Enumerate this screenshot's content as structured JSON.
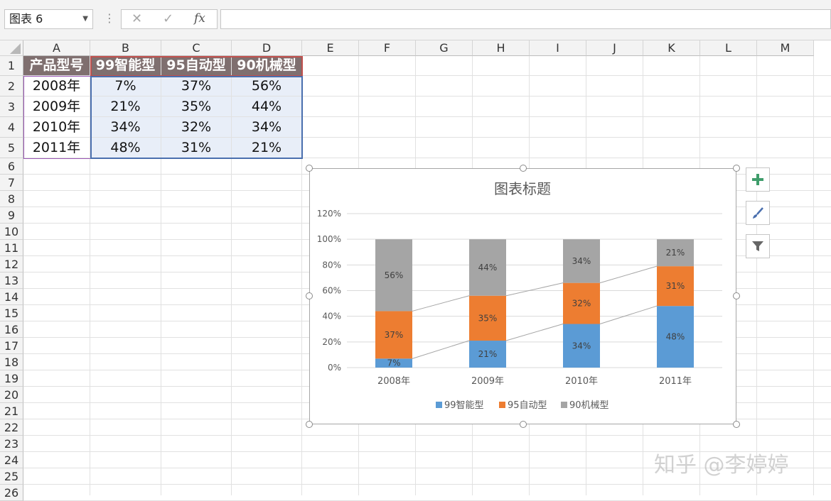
{
  "formula_bar": {
    "name_box": "图表 6",
    "cancel_icon": "✕",
    "enter_icon": "✓",
    "fx_icon": "fx",
    "formula": ""
  },
  "columns": [
    "A",
    "B",
    "C",
    "D",
    "E",
    "F",
    "G",
    "H",
    "I",
    "J",
    "K",
    "L",
    "M"
  ],
  "rows": [
    "1",
    "2",
    "3",
    "4",
    "5",
    "6",
    "7",
    "8",
    "9",
    "10",
    "11",
    "12",
    "13",
    "14",
    "15",
    "16",
    "17",
    "18",
    "19",
    "20",
    "21",
    "22",
    "23",
    "24",
    "25",
    "26"
  ],
  "table": {
    "headers": [
      "产品型号",
      "99智能型",
      "95自动型",
      "90机械型"
    ],
    "rows": [
      [
        "2008年",
        "7%",
        "37%",
        "56%"
      ],
      [
        "2009年",
        "21%",
        "35%",
        "44%"
      ],
      [
        "2010年",
        "34%",
        "32%",
        "34%"
      ],
      [
        "2011年",
        "48%",
        "31%",
        "21%"
      ]
    ]
  },
  "chart_data": {
    "type": "bar",
    "stacked": true,
    "title": "图表标题",
    "categories": [
      "2008年",
      "2009年",
      "2010年",
      "2011年"
    ],
    "series": [
      {
        "name": "99智能型",
        "values": [
          7,
          21,
          34,
          48
        ],
        "color": "#5b9bd5"
      },
      {
        "name": "95自动型",
        "values": [
          37,
          35,
          32,
          31
        ],
        "color": "#ed7d31"
      },
      {
        "name": "90机械型",
        "values": [
          56,
          44,
          34,
          21
        ],
        "color": "#a5a5a5"
      }
    ],
    "data_labels": [
      [
        "7%",
        "21%",
        "34%",
        "48%"
      ],
      [
        "37%",
        "35%",
        "32%",
        "31%"
      ],
      [
        "56%",
        "44%",
        "34%",
        "21%"
      ]
    ],
    "series_lines": true,
    "ylim": [
      0,
      120
    ],
    "yticks": [
      "0%",
      "20%",
      "40%",
      "60%",
      "80%",
      "100%",
      "120%"
    ],
    "ytick_values": [
      0,
      20,
      40,
      60,
      80,
      100,
      120
    ],
    "grid": true,
    "legend_position": "bottom"
  },
  "chart_buttons": {
    "add_icon": "plus-icon",
    "style_icon": "brush-icon",
    "filter_icon": "filter-icon"
  },
  "watermark": "知乎 @李婷婷"
}
